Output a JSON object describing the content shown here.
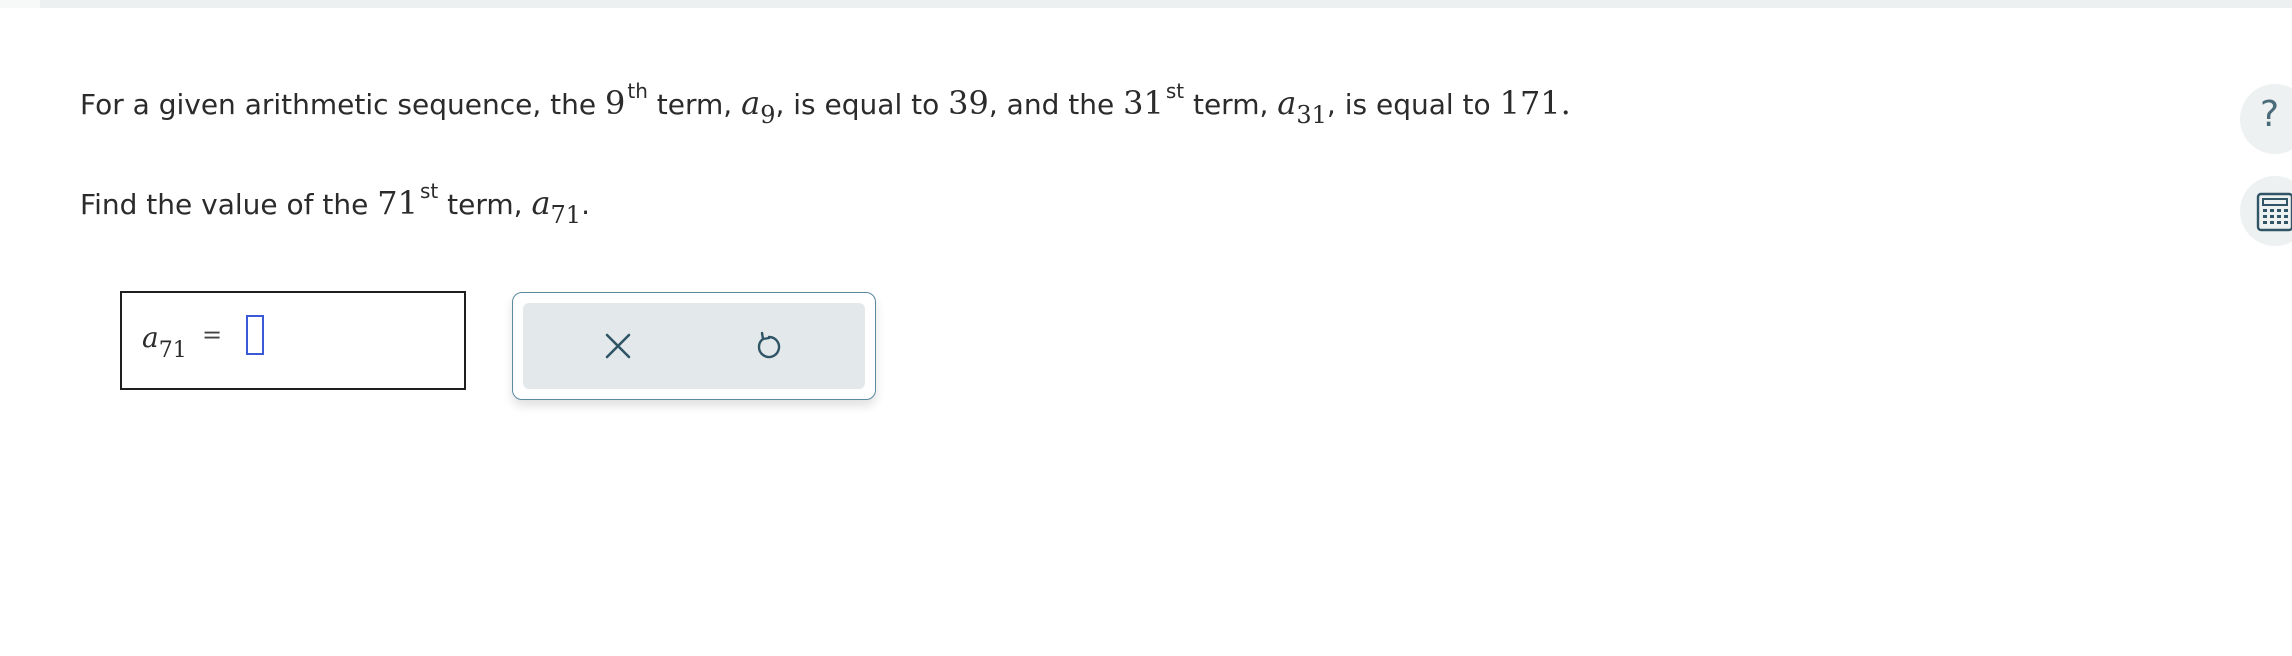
{
  "problem": {
    "line1": {
      "t1": "For a given arithmetic sequence, the ",
      "n1": "9",
      "sup1": "th",
      "t2": " term, ",
      "var1": "a",
      "sub1": "9",
      "t3": ", is equal to ",
      "v1": "39",
      "t4": ", and the ",
      "n2": "31",
      "sup2": "st",
      "t5": " term, ",
      "var2": "a",
      "sub2": "31",
      "t6": ", is equal to ",
      "v2": "171",
      "t7": "."
    },
    "line2": {
      "t1": "Find the value of the ",
      "n1": "71",
      "sup1": "st",
      "t2": " term, ",
      "var1": "a",
      "sub1": "71",
      "t3": "."
    }
  },
  "answer": {
    "var": "a",
    "sub": "71",
    "equals": "=",
    "value": ""
  },
  "tools": {
    "clear_icon": "close-icon",
    "undo_icon": "undo-icon"
  },
  "sidebar": {
    "help_glyph": "?",
    "help_icon": "help-icon",
    "calculator_icon": "calculator-icon"
  },
  "colors": {
    "input_border": "#3a5ad8",
    "panel_border": "#5a8a9e",
    "panel_fill": "#e3e9ea",
    "icon_color": "#2f5566"
  }
}
